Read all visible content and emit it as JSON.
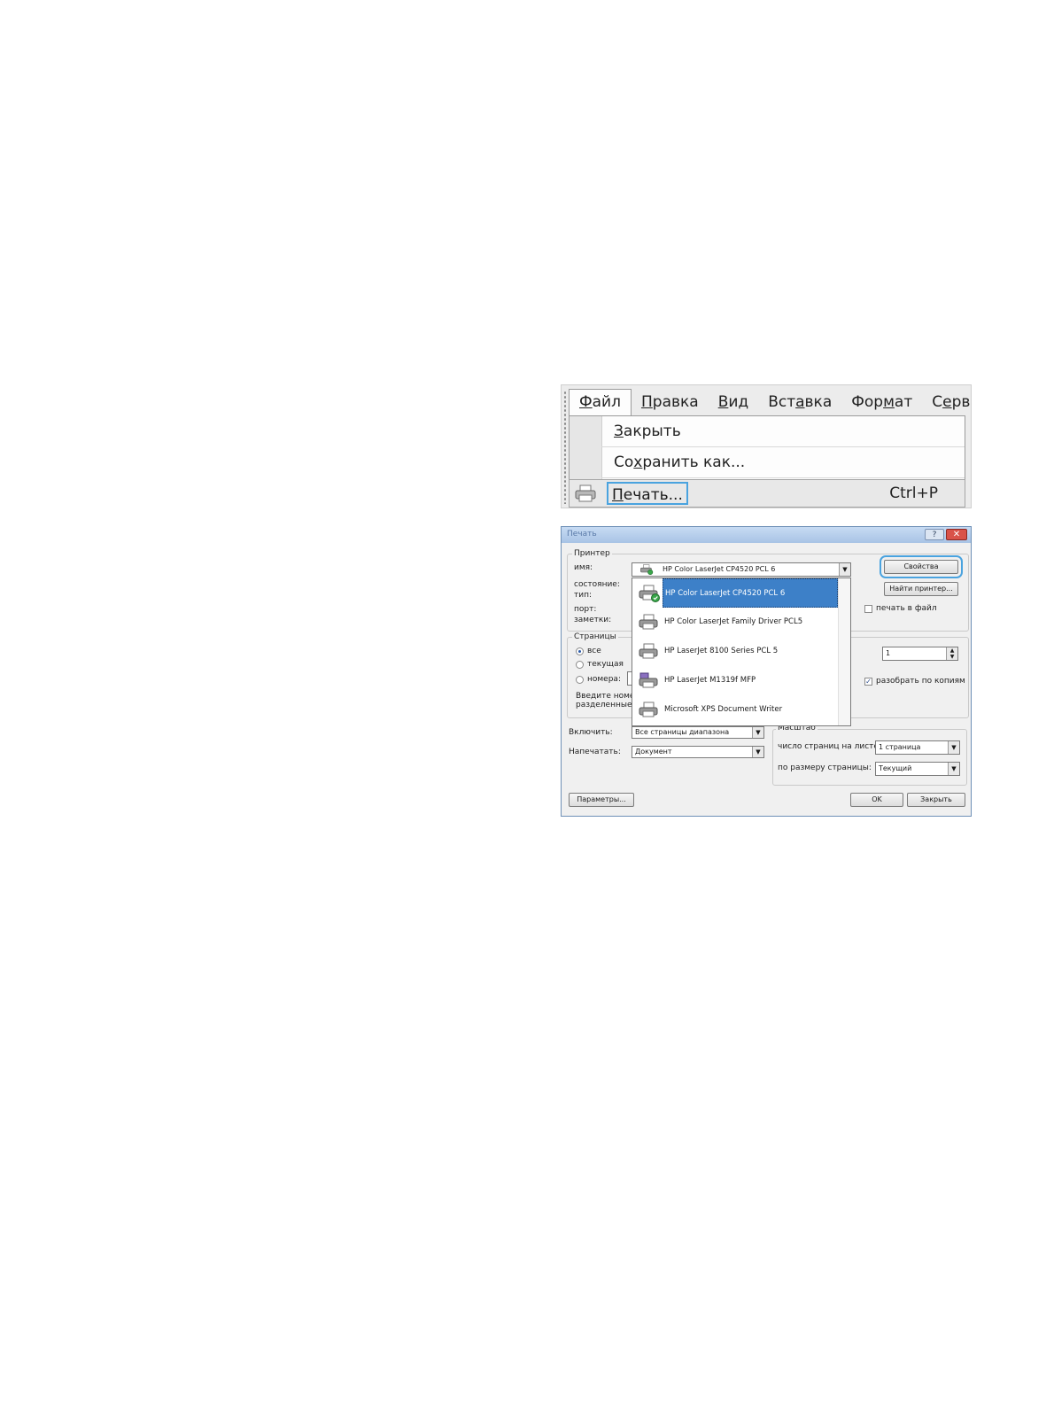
{
  "menu": {
    "bar": [
      {
        "pre": "",
        "u": "Ф",
        "post": "айл"
      },
      {
        "pre": "",
        "u": "П",
        "post": "равка"
      },
      {
        "pre": "",
        "u": "В",
        "post": "ид"
      },
      {
        "pre": "Вст",
        "u": "а",
        "post": "вка"
      },
      {
        "pre": "Фор",
        "u": "м",
        "post": "ат"
      },
      {
        "pre": "С",
        "u": "е",
        "post": "рвис"
      }
    ],
    "items": [
      {
        "pre": "",
        "u": "З",
        "post": "акрыть"
      },
      {
        "pre": "Со",
        "u": "х",
        "post": "ранить как..."
      }
    ],
    "print": {
      "pre": "",
      "u": "П",
      "post": "ечать...",
      "shortcut": "Ctrl+P",
      "icon": "printer-icon"
    }
  },
  "dialog": {
    "title": "Печать",
    "help_label": "?",
    "close_label": "✕",
    "printer_group": "Принтер",
    "name_label": "имя:",
    "selected_printer": "HP Color LaserJet CP4520 PCL 6",
    "status_label": "состояние:",
    "type_label": "тип:",
    "port_label": "порт:",
    "notes_label": "заметки:",
    "properties_button": "Свойства",
    "find_printer_button": "Найти принтер...",
    "print_to_file": "печать в файл",
    "print_to_file_checked": false,
    "pages_group": "Страницы",
    "pages_all": "все",
    "pages_current": "текущая",
    "pages_numbers": "номера:",
    "pages_hint_1": "Введите номер",
    "pages_hint_2": "разделенные з",
    "copies_value": "1",
    "collate_label": "разобрать по копиям",
    "collate_checked": true,
    "include_label": "Включить:",
    "include_value": "Все страницы диапазона",
    "print_what_label": "Напечатать:",
    "print_what_value": "Документ",
    "scale_group": "Масштаб",
    "pages_per_sheet_label": "число страниц на листе:",
    "pages_per_sheet_value": "1 страница",
    "fit_to_page_label": "по размеру страницы:",
    "fit_to_page_value": "Текущий",
    "options_button": "Параметры...",
    "ok_button": "OK",
    "close_button": "Закрыть",
    "printers": [
      {
        "name": "HP Color LaserJet CP4520 PCL 6",
        "selected": true,
        "icon": "printer-default-icon"
      },
      {
        "name": "HP Color LaserJet Family Driver PCL5",
        "selected": false,
        "icon": "printer-icon"
      },
      {
        "name": "HP LaserJet 8100 Series PCL 5",
        "selected": false,
        "icon": "printer-icon"
      },
      {
        "name": "HP LaserJet M1319f MFP",
        "selected": false,
        "icon": "fax-printer-icon"
      },
      {
        "name": "Microsoft XPS Document Writer",
        "selected": false,
        "icon": "printer-icon"
      }
    ]
  },
  "colors": {
    "highlight": "#4aa3df",
    "selection": "#3d80c8",
    "close_red": "#d9534a"
  }
}
